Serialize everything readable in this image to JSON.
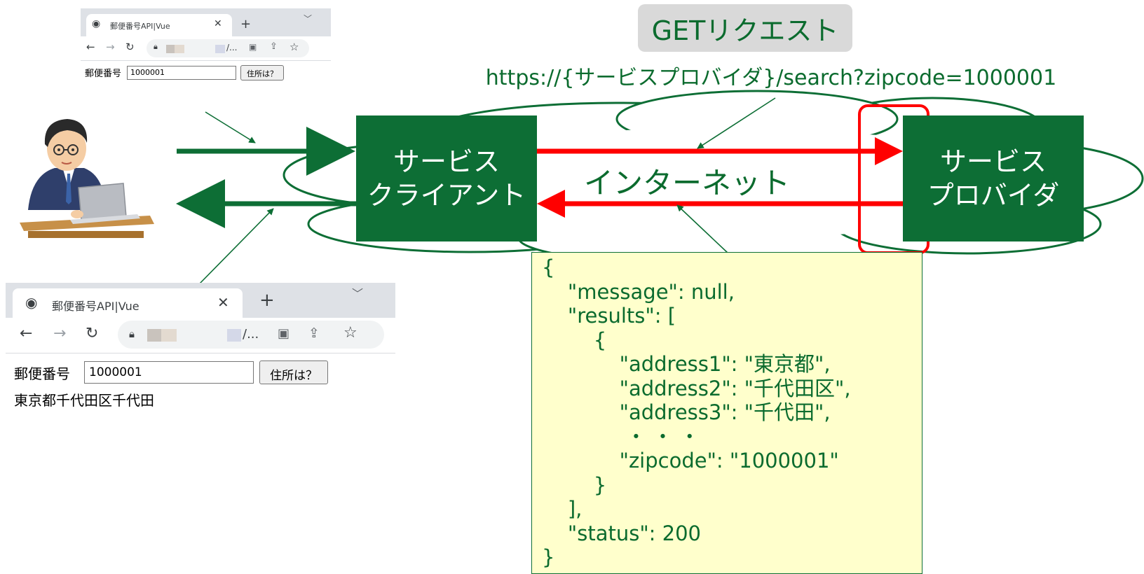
{
  "request_method_label": "GETリクエスト",
  "request_url": "https://{サービスプロバイダ}/search?zipcode=1000001",
  "client_box": {
    "line1": "サービス",
    "line2": "クライアント"
  },
  "provider_box": {
    "line1": "サービス",
    "line2": "プロバイダ"
  },
  "internet_label": "インターネット",
  "json_response": [
    "{",
    "    \"message\": null,",
    "    \"results\": [",
    "        {",
    "            \"address1\": \"東京都\",",
    "            \"address2\": \"千代田区\",",
    "            \"address3\": \"千代田\",",
    "             ・ ・ ・",
    "            \"zipcode\": \"1000001\"",
    "        }",
    "    ],",
    "    \"status\": 200",
    "}"
  ],
  "browser_small": {
    "tab_title": "郵便番号API|Vue",
    "url_suffix": "/...",
    "field_label": "郵便番号",
    "field_value": "1000001",
    "button_label": "住所は？"
  },
  "browser_large": {
    "tab_title": "郵便番号API|Vue",
    "url_suffix": "/...",
    "field_label": "郵便番号",
    "field_value": "1000001",
    "button_label": "住所は？",
    "result_text": "東京都千代田区千代田"
  },
  "colors": {
    "green": "#0d6e35",
    "green_text": "#0b6b2e",
    "red": "#ff0000",
    "json_bg": "#ffffcc",
    "get_bg": "#d9d9d9"
  }
}
